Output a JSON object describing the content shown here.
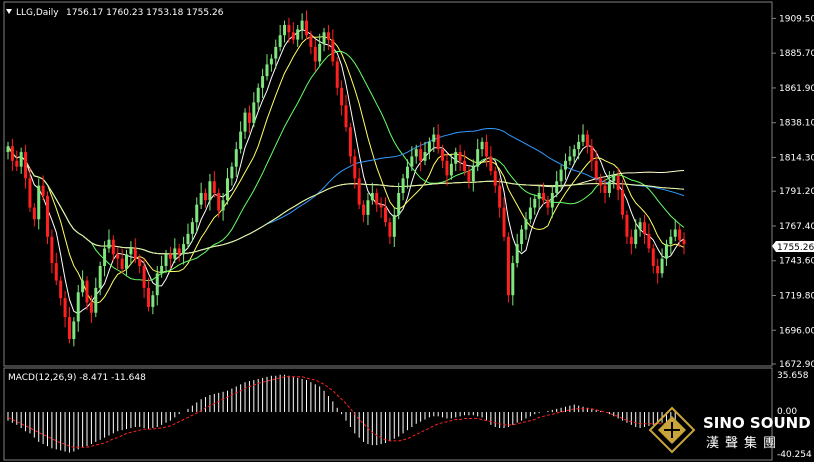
{
  "header": {
    "symbol": "LLG,Daily",
    "ohlc": "1756.17 1760.23 1753.18 1755.26"
  },
  "macd": {
    "label": "MACD(12,26,9) -8.471 -11.648",
    "ticks": [
      "35.658",
      "0.00",
      "-40.254"
    ]
  },
  "logo": {
    "main": "SINO SOUND",
    "sub": "漢聲集團"
  },
  "colors": {
    "background": "#000000",
    "bull": "#7fe57f",
    "bear": "#ff2020",
    "macd_signal": "#ff2020",
    "macd_hist": "#ffffff",
    "ma5": "#ffffff",
    "ma10": "#ffff66",
    "ma20": "#66ff66",
    "ma60": "#3399ff",
    "ma120": "#ffffcc",
    "ma200": "#ff55aa",
    "ma250": "#ccff99",
    "price_tag_bg": "#ffffff"
  },
  "chart_data": {
    "type": "candlestick",
    "symbol": "LLG",
    "timeframe": "Daily",
    "last_price": 1755.26,
    "last_price_label": "1755.26",
    "ylim": [
      1672.9,
      1918
    ],
    "yticks": [
      1672.9,
      1696.0,
      1719.8,
      1743.6,
      1767.4,
      1791.2,
      1814.3,
      1838.1,
      1861.9,
      1885.7,
      1909.5
    ],
    "ytick_labels": [
      "1672.90",
      "1696.00",
      "1719.80",
      "1743.60",
      "1767.40",
      "1791.20",
      "1814.30",
      "1838.10",
      "1861.90",
      "1885.70",
      "1909.50"
    ],
    "close": [
      1822,
      1812,
      1808,
      1818,
      1800,
      1780,
      1772,
      1795,
      1788,
      1760,
      1742,
      1730,
      1718,
      1705,
      1690,
      1702,
      1722,
      1730,
      1715,
      1708,
      1725,
      1740,
      1752,
      1758,
      1748,
      1745,
      1738,
      1748,
      1752,
      1745,
      1740,
      1725,
      1712,
      1720,
      1735,
      1740,
      1748,
      1745,
      1752,
      1748,
      1755,
      1762,
      1770,
      1782,
      1790,
      1785,
      1798,
      1790,
      1778,
      1785,
      1800,
      1808,
      1820,
      1832,
      1845,
      1838,
      1852,
      1862,
      1870,
      1878,
      1882,
      1890,
      1898,
      1905,
      1900,
      1895,
      1902,
      1908,
      1898,
      1890,
      1880,
      1892,
      1900,
      1895,
      1880,
      1862,
      1850,
      1835,
      1815,
      1800,
      1782,
      1775,
      1785,
      1790,
      1782,
      1780,
      1770,
      1760,
      1775,
      1790,
      1800,
      1808,
      1815,
      1820,
      1812,
      1818,
      1825,
      1830,
      1820,
      1812,
      1802,
      1810,
      1818,
      1812,
      1805,
      1798,
      1808,
      1820,
      1825,
      1815,
      1805,
      1795,
      1780,
      1760,
      1720,
      1742,
      1755,
      1765,
      1772,
      1780,
      1786,
      1790,
      1785,
      1780,
      1790,
      1798,
      1806,
      1812,
      1815,
      1820,
      1825,
      1830,
      1822,
      1812,
      1800,
      1795,
      1790,
      1798,
      1802,
      1792,
      1775,
      1760,
      1755,
      1765,
      1770,
      1762,
      1752,
      1740,
      1735,
      1745,
      1755,
      1760,
      1765,
      1758,
      1755
    ],
    "macd_hist": [
      -8,
      -10,
      -12,
      -15,
      -18,
      -20,
      -24,
      -28,
      -30,
      -32,
      -34,
      -35,
      -36,
      -37,
      -38,
      -37,
      -35,
      -33,
      -32,
      -30,
      -28,
      -26,
      -24,
      -22,
      -20,
      -18,
      -17,
      -16,
      -15,
      -14,
      -14,
      -15,
      -16,
      -15,
      -14,
      -12,
      -10,
      -8,
      -5,
      -2,
      0,
      3,
      6,
      9,
      12,
      14,
      16,
      17,
      18,
      19,
      20,
      22,
      24,
      26,
      28,
      29,
      30,
      31,
      32,
      33,
      34,
      34,
      35,
      35,
      34,
      33,
      32,
      31,
      30,
      28,
      26,
      24,
      20,
      15,
      10,
      4,
      -2,
      -8,
      -14,
      -20,
      -24,
      -28,
      -30,
      -31,
      -31,
      -30,
      -29,
      -27,
      -25,
      -23,
      -20,
      -17,
      -14,
      -11,
      -9,
      -7,
      -5,
      -4,
      -4,
      -5,
      -6,
      -6,
      -5,
      -4,
      -3,
      -3,
      -3,
      -4,
      -5,
      -8,
      -12,
      -14,
      -15,
      -15,
      -14,
      -12,
      -10,
      -8,
      -6,
      -4,
      -2,
      -1,
      0,
      1,
      2,
      3,
      4,
      5,
      6,
      7,
      6,
      5,
      4,
      3,
      2,
      1,
      0,
      -2,
      -4,
      -6,
      -8,
      -10,
      -12,
      -14,
      -15,
      -14,
      -13,
      -12,
      -11,
      -10,
      -9,
      -9,
      -8
    ],
    "macd_signal": [
      -5,
      -7,
      -9,
      -11,
      -13,
      -15,
      -17,
      -19,
      -21,
      -23,
      -25,
      -27,
      -29,
      -30,
      -32,
      -33,
      -33,
      -33,
      -33,
      -32,
      -31,
      -30,
      -29,
      -27,
      -25,
      -24,
      -22,
      -20,
      -19,
      -18,
      -17,
      -16,
      -16,
      -16,
      -15,
      -15,
      -14,
      -13,
      -11,
      -9,
      -7,
      -5,
      -3,
      -1,
      1,
      4,
      6,
      8,
      10,
      12,
      14,
      16,
      18,
      20,
      22,
      24,
      25,
      27,
      28,
      29,
      30,
      31,
      32,
      33,
      33,
      33,
      33,
      33,
      32,
      31,
      30,
      28,
      26,
      23,
      20,
      16,
      12,
      8,
      3,
      -2,
      -7,
      -11,
      -15,
      -19,
      -22,
      -24,
      -26,
      -27,
      -27,
      -27,
      -26,
      -25,
      -23,
      -21,
      -19,
      -17,
      -15,
      -13,
      -11,
      -10,
      -9,
      -8,
      -7,
      -7,
      -6,
      -6,
      -6,
      -6,
      -7,
      -8,
      -9,
      -10,
      -11,
      -12,
      -12,
      -12,
      -11,
      -10,
      -9,
      -8,
      -7,
      -5,
      -4,
      -3,
      -2,
      -1,
      0,
      1,
      2,
      3,
      3,
      3,
      3,
      3,
      2,
      1,
      0,
      -1,
      -3,
      -4,
      -6,
      -8,
      -9,
      -10,
      -11,
      -11,
      -11,
      -11,
      -11,
      -11,
      -11,
      -11
    ]
  }
}
